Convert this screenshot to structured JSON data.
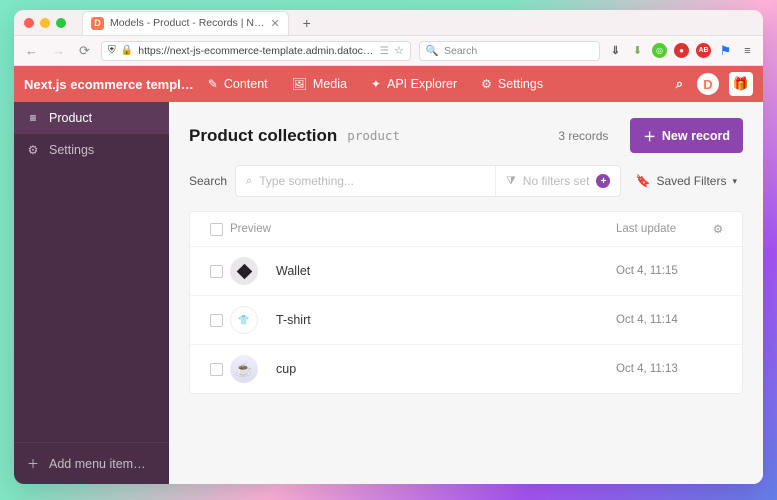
{
  "browser": {
    "tab_title": "Models - Product - Records | N…",
    "url": "https://next-js-ecommerce-template.admin.datocms.com/edi",
    "search_placeholder": "Search"
  },
  "appHeader": {
    "title": "Next.js ecommerce templ…",
    "nav": {
      "content": "Content",
      "media": "Media",
      "api": "API Explorer",
      "settings": "Settings"
    }
  },
  "sidebar": {
    "items": [
      {
        "icon": "≡",
        "label": "Product",
        "active": true
      },
      {
        "icon": "⚙",
        "label": "Settings",
        "active": false
      }
    ],
    "add_label": "Add menu item…"
  },
  "collection": {
    "title": "Product collection",
    "api_id": "product",
    "record_count": "3 records",
    "new_button": "New record"
  },
  "search": {
    "label": "Search",
    "placeholder": "Type something...",
    "filters_label": "No filters set",
    "saved_label": "Saved Filters"
  },
  "table": {
    "columns": {
      "preview": "Preview",
      "last_update": "Last update"
    },
    "rows": [
      {
        "name": "Wallet",
        "updated": "Oct 4, 11:15",
        "thumb": "diamond"
      },
      {
        "name": "T-shirt",
        "updated": "Oct 4, 11:14",
        "thumb": "shirt"
      },
      {
        "name": "cup",
        "updated": "Oct 4, 11:13",
        "thumb": "cup"
      }
    ]
  }
}
